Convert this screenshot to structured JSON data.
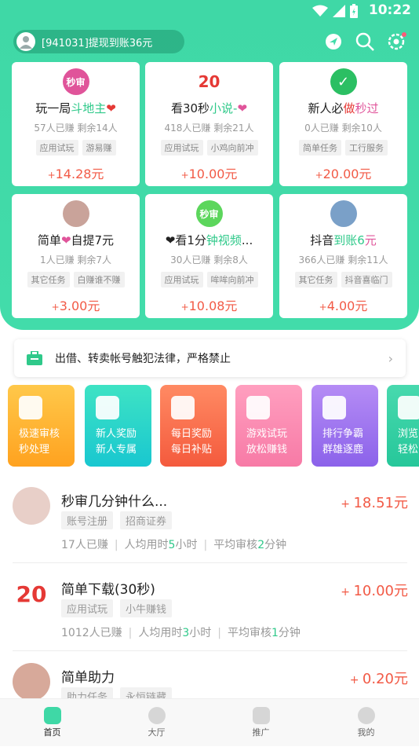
{
  "status": {
    "time": "10:22"
  },
  "header": {
    "notice": "[941031]提现到账36元"
  },
  "tasks": [
    {
      "badge": "秒审",
      "title_a": "玩一局",
      "title_b": "斗地主",
      "title_c": "❤",
      "meta": "57人已赚  剩余14人",
      "tags": [
        "应用试玩",
        "游易赚"
      ],
      "price": "14.28元",
      "color": "#e0549a"
    },
    {
      "badge": "20",
      "title_a": "看30秒",
      "title_b": "小说-",
      "title_c": "❤",
      "meta": "418人已赚  剩余21人",
      "tags": [
        "应用试玩",
        "小鸡向前冲"
      ],
      "price": "10.00元",
      "color": "#e53935"
    },
    {
      "badge": "✓",
      "title_a": "新人必",
      "title_b": "做",
      "title_c": "秒过",
      "meta": "0人已赚  剩余10人",
      "tags": [
        "简单任务",
        "工行服务"
      ],
      "price": "20.00元",
      "color": "#2bbf63"
    },
    {
      "badge": "",
      "title_a": "简单",
      "title_b": "❤",
      "title_c": "自提7元",
      "meta": "1人已赚  剩余7人",
      "tags": [
        "其它任务",
        "白赚谁不赚"
      ],
      "price": "3.00元",
      "color": "#c9a39a"
    },
    {
      "badge": "秒审",
      "title_a": "❤看1分",
      "title_b": "钟视频",
      "title_c": "...",
      "meta": "30人已赚  剩余8人",
      "tags": [
        "应用试玩",
        "哞哞向前冲"
      ],
      "price": "10.08元",
      "color": "#5cd65c"
    },
    {
      "badge": "",
      "title_a": "抖音",
      "title_b": "到账6",
      "title_c": "元",
      "meta": "366人已赚  剩余11人",
      "tags": [
        "其它任务",
        "抖音喜临门"
      ],
      "price": "4.00元",
      "color": "#7aa0c8"
    }
  ],
  "rule_notice": "出借、转卖帐号触犯法律，严格禁止",
  "categories": [
    {
      "l1": "极速审核",
      "l2": "秒处理",
      "c1": "#ffc84a",
      "c2": "#ffa21f"
    },
    {
      "l1": "新人奖励",
      "l2": "新人专属",
      "c1": "#3ee3c4",
      "c2": "#19c7d0"
    },
    {
      "l1": "每日奖励",
      "l2": "每日补贴",
      "c1": "#ff8a63",
      "c2": "#f45a3d"
    },
    {
      "l1": "游戏试玩",
      "l2": "放松赚钱",
      "c1": "#ff9fbf",
      "c2": "#f77aa6"
    },
    {
      "l1": "排行争霸",
      "l2": "群雄逐鹿",
      "c1": "#b58cf5",
      "c2": "#8b62ea"
    },
    {
      "l1": "浏览",
      "l2": "轻松",
      "c1": "#48d9ae",
      "c2": "#26c79a"
    }
  ],
  "list": [
    {
      "name": "秒审几分钟什么...",
      "price": "18.51元",
      "tags": [
        "账号注册",
        "招商证券"
      ],
      "earned": "17人已赚",
      "avg_use_a": "人均用时",
      "avg_use_n": "5",
      "avg_use_u": "小时",
      "avg_rev_a": "平均审核",
      "avg_rev_n": "2",
      "avg_rev_u": "分钟",
      "thumb": "#e8cfc8"
    },
    {
      "name": "简单下载(30秒)",
      "price": "10.00元",
      "tags": [
        "应用试玩",
        "小牛赚钱"
      ],
      "earned": "1012人已赚",
      "avg_use_a": "人均用时",
      "avg_use_n": "3",
      "avg_use_u": "小时",
      "avg_rev_a": "平均审核",
      "avg_rev_n": "1",
      "avg_rev_u": "分钟",
      "thumb": "#ffffff"
    },
    {
      "name": "简单助力",
      "price": "0.20元",
      "tags": [
        "助力任务",
        "永恒链藏"
      ],
      "earned": "",
      "thumb": "#d7a99a"
    }
  ],
  "tabs": [
    {
      "label": "首页"
    },
    {
      "label": "大厅"
    },
    {
      "label": "推广"
    },
    {
      "label": "我的"
    }
  ]
}
